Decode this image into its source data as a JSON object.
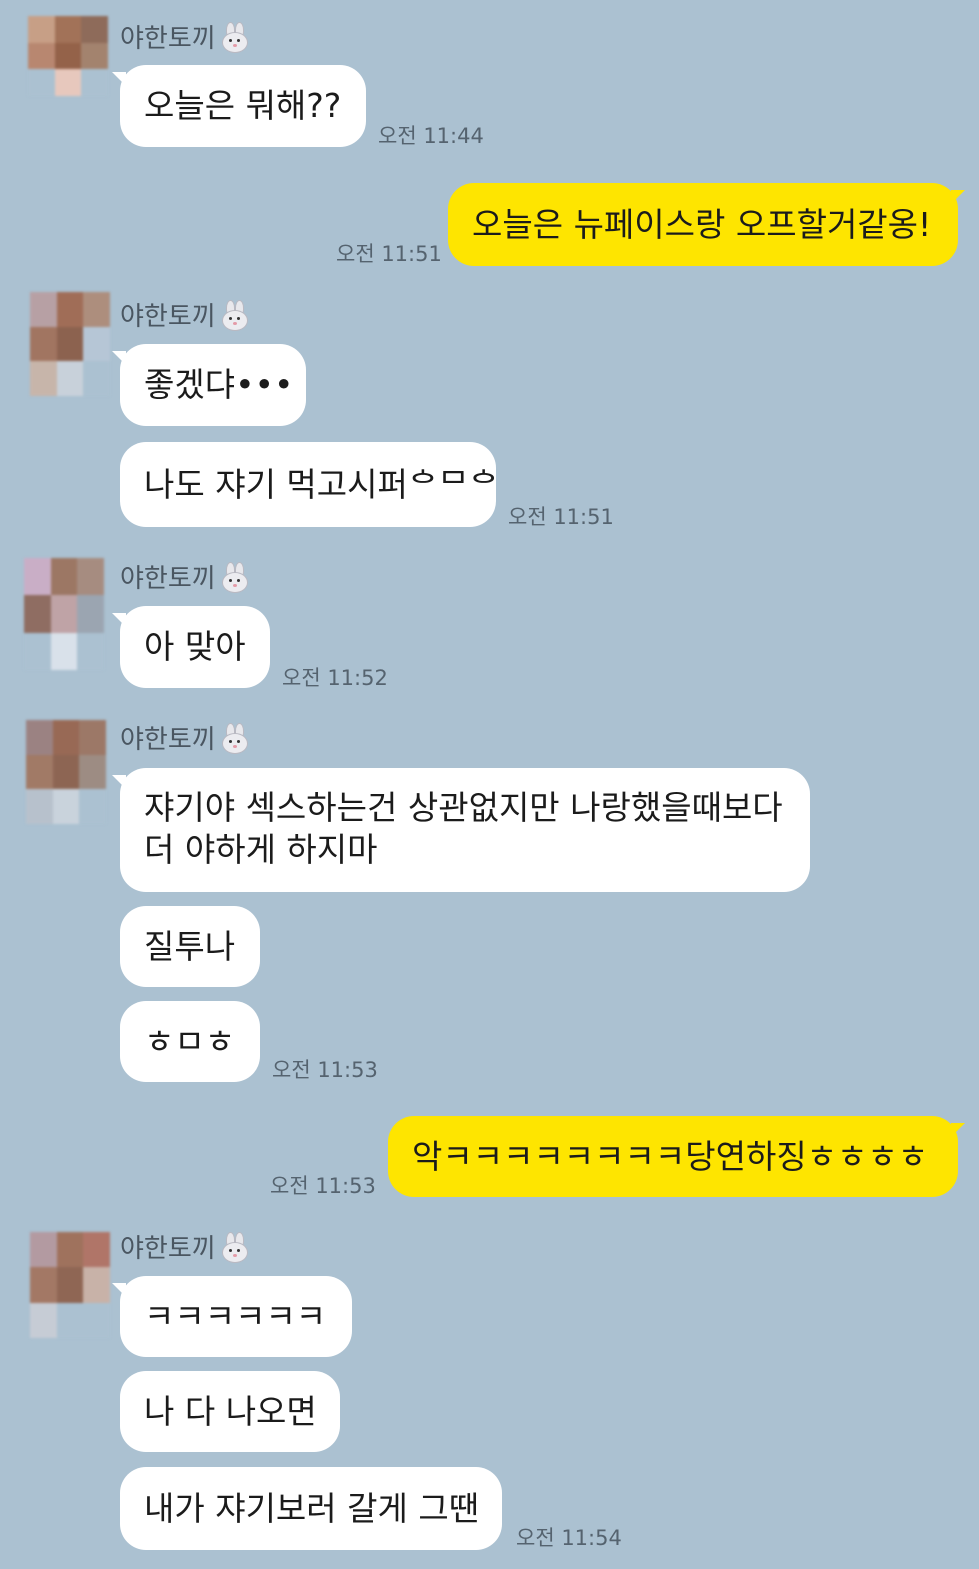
{
  "sender": {
    "name": "야한토끼",
    "name_icon": "rabbit-face-icon",
    "avatar": "blurred-avatar"
  },
  "colors": {
    "background": "#abc1d1",
    "incoming_bubble": "#ffffff",
    "outgoing_bubble": "#fee500"
  },
  "messages": {
    "m1": {
      "text": "오늘은 뭐해??",
      "time": "오전 11:44"
    },
    "m2": {
      "text": "오늘은 뉴페이스랑 오프할거같옹!",
      "time": "오전 11:51"
    },
    "m3": {
      "text": "좋겠댜•••"
    },
    "m4": {
      "text": "나도 쟈기 먹고시퍼ᅌᄆᅌ",
      "time": "오전 11:51"
    },
    "m5": {
      "text": "아 맞아",
      "time": "오전 11:52"
    },
    "m6": {
      "line1": "쟈기야 섹스하는건 상관없지만 나랑했을때보다",
      "line2": "더 야하게 하지마"
    },
    "m7": {
      "text": "질투나"
    },
    "m8": {
      "text": "ㅎㅁㅎ",
      "time": "오전 11:53"
    },
    "m9": {
      "text": "악ㅋㅋㅋㅋㅋㅋㅋㅋ당연하징ㅎㅎㅎㅎ",
      "time": "오전 11:53"
    },
    "m10": {
      "text": "ㅋㅋㅋㅋㅋㅋ"
    },
    "m11": {
      "text": "나 다 나오면"
    },
    "m12": {
      "text": "내가 쟈기보러 갈게 그땐",
      "time": "오전 11:54"
    }
  }
}
